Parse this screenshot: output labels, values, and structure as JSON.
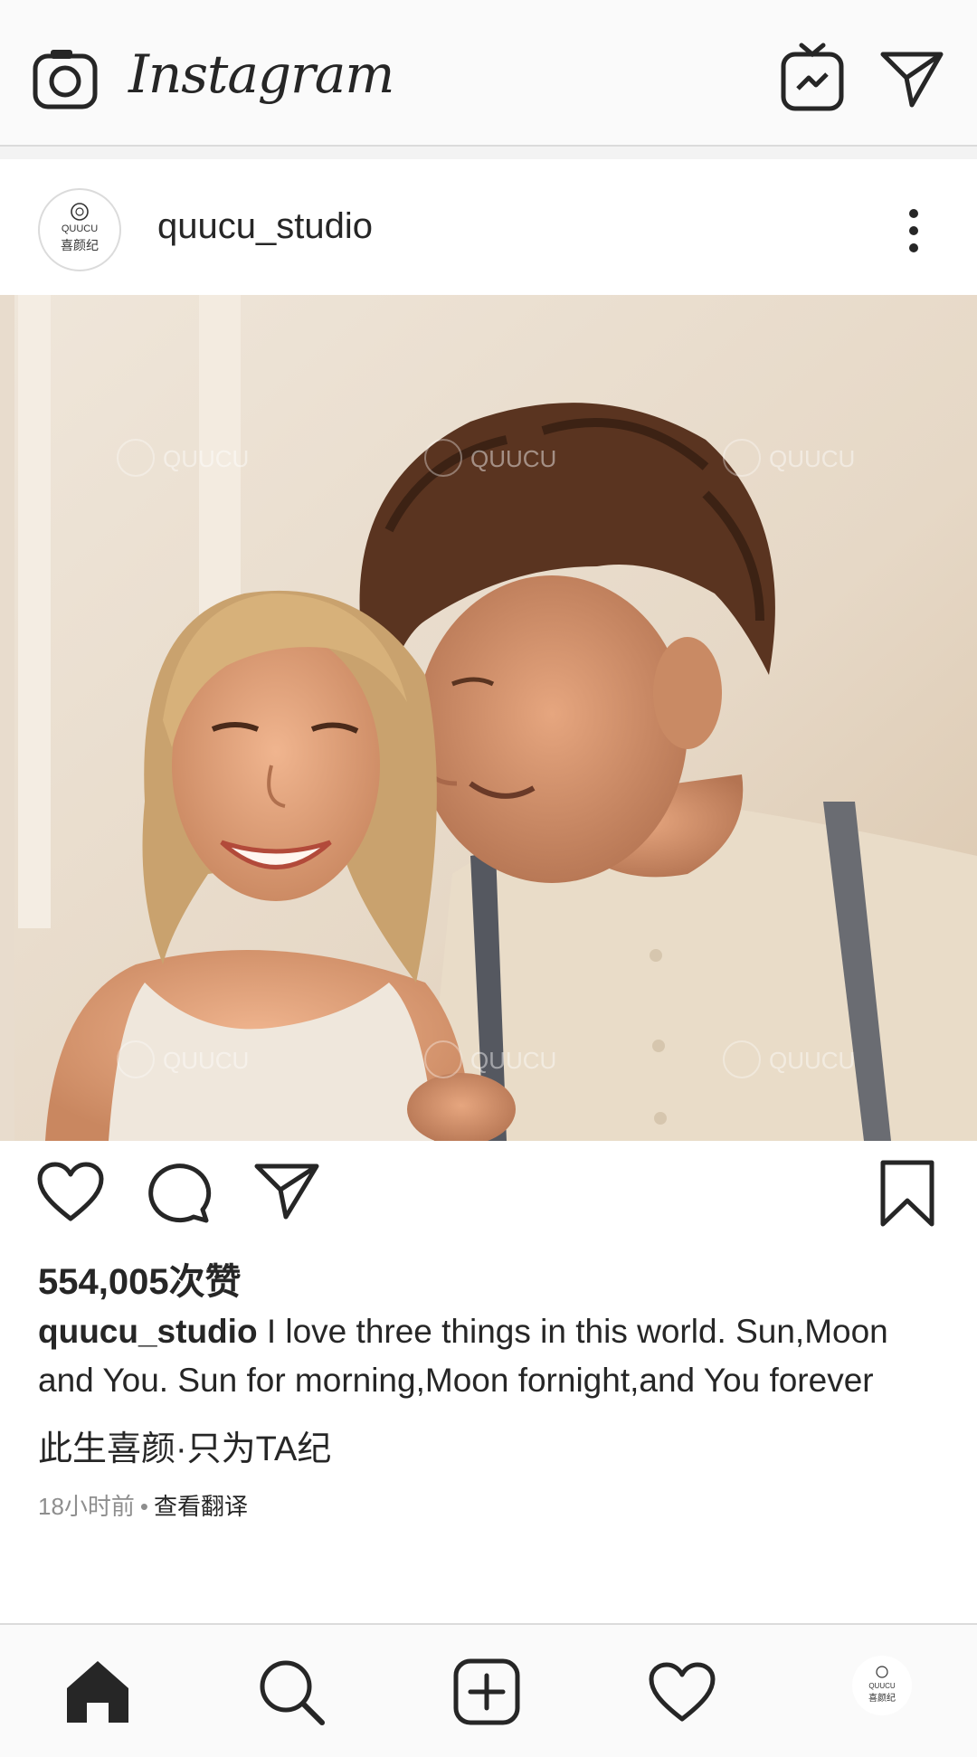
{
  "app": {
    "brand": "Instagram",
    "icons": [
      "camera-icon",
      "igtv-icon",
      "direct-message-icon"
    ]
  },
  "post": {
    "username": "quucu_studio",
    "avatar_text": "QUUCU",
    "avatar_subtext": "喜颜纪",
    "photo_description_icon": "photo",
    "watermark": "QUUCU",
    "likes": "554,005次赞",
    "caption_user": "quucu_studio",
    "caption_text": " I love three things in this world. Sun,Moon and You. Sun for morning,Moon fornight,and You forever",
    "caption_line2": "此生喜颜·只为TA纪",
    "time_ago": "18小时前",
    "separator": "•",
    "translate": "查看翻译"
  },
  "nav": {
    "items": [
      "home-icon",
      "search-icon",
      "add-icon",
      "heart-icon",
      "profile-avatar"
    ]
  },
  "colors": {
    "text": "#262626",
    "muted": "#8e8e8e",
    "border": "#dbdbdb",
    "bar_bg": "#fafafa"
  }
}
